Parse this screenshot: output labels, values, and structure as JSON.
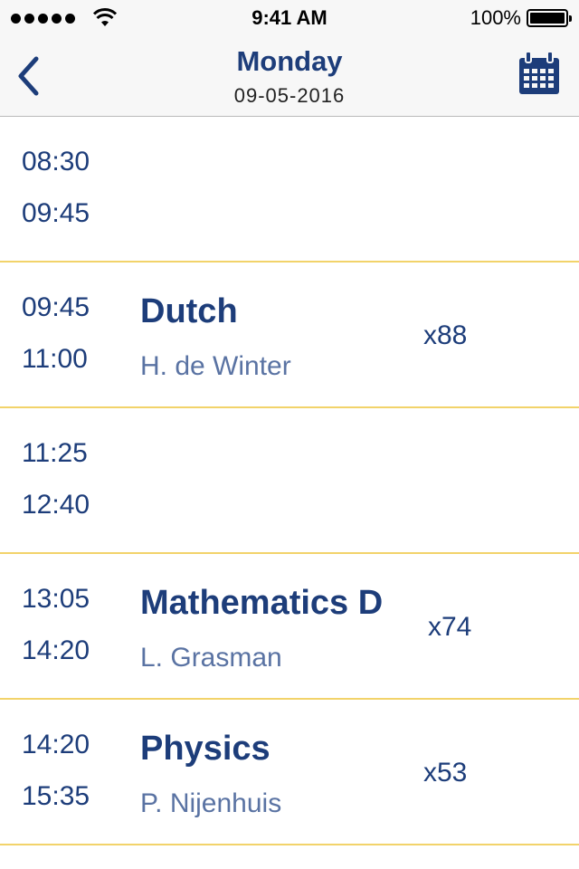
{
  "status_bar": {
    "time": "9:41 AM",
    "battery": "100%",
    "battery_level": 1.0,
    "signal_dots": 5,
    "icons": [
      "signal-dots-icon",
      "wifi-icon",
      "battery-icon"
    ]
  },
  "nav": {
    "title": "Monday",
    "subtitle": "09-05-2016",
    "back_icon": "chevron-left-icon",
    "calendar_icon": "calendar-icon"
  },
  "colors": {
    "primary": "#1d3d7a",
    "secondary_text": "#5a73a3",
    "divider": "#f2d36a",
    "bar_bg": "#f7f7f7"
  },
  "schedule": [
    {
      "start": "08:30",
      "end": "09:45",
      "subject": "",
      "teacher": "",
      "room": ""
    },
    {
      "start": "09:45",
      "end": "11:00",
      "subject": "Dutch",
      "teacher": "H. de Winter",
      "room": "x88"
    },
    {
      "start": "11:25",
      "end": "12:40",
      "subject": "",
      "teacher": "",
      "room": ""
    },
    {
      "start": "13:05",
      "end": "14:20",
      "subject": "Mathematics D",
      "teacher": "L. Grasman",
      "room": "x74"
    },
    {
      "start": "14:20",
      "end": "15:35",
      "subject": "Physics",
      "teacher": "P. Nijenhuis",
      "room": "x53"
    }
  ]
}
